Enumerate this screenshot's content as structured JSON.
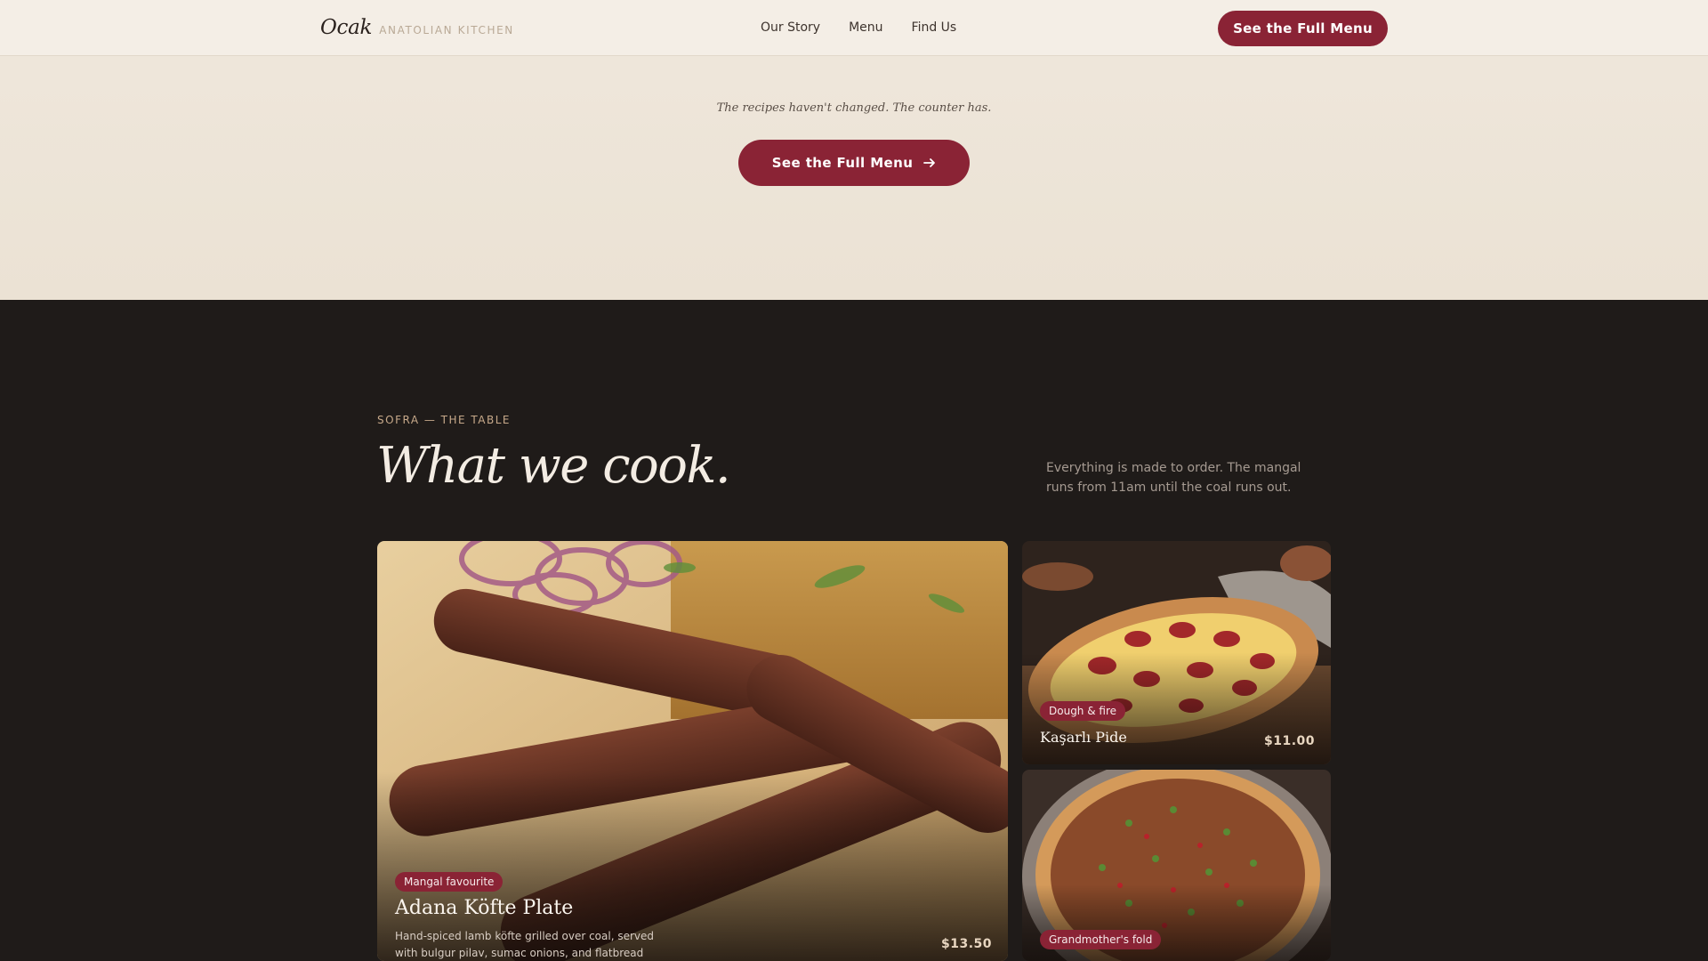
{
  "nav": {
    "brand_name": "Ocak",
    "brand_tagline": "ANATOLIAN KITCHEN",
    "links": [
      "Our Story",
      "Menu",
      "Find Us"
    ],
    "cta_label": "See the Full Menu"
  },
  "hero": {
    "tagline": "The recipes haven't changed. The counter has.",
    "cta_label": "See the Full Menu",
    "cta_icon": "arrow-right-icon"
  },
  "menu_section": {
    "eyebrow": "SOFRA — THE TABLE",
    "title": "What we cook.",
    "description": "Everything is made to order. The mangal runs from 11am until the coal runs out.",
    "items": [
      {
        "badge": "Mangal favourite",
        "name": "Adana Köfte Plate",
        "description": "Hand-spiced lamb köfte grilled over coal, served with bulgur pilav, sumac onions, and flatbread",
        "price": "$13.50"
      },
      {
        "badge": "Dough & fire",
        "name": "Kaşarlı Pide",
        "price": "$11.00"
      },
      {
        "badge": "Grandmother's fold"
      }
    ]
  },
  "colors": {
    "accent": "#8a2335",
    "cream": "#efe7dc",
    "dark": "#1f1b19"
  }
}
